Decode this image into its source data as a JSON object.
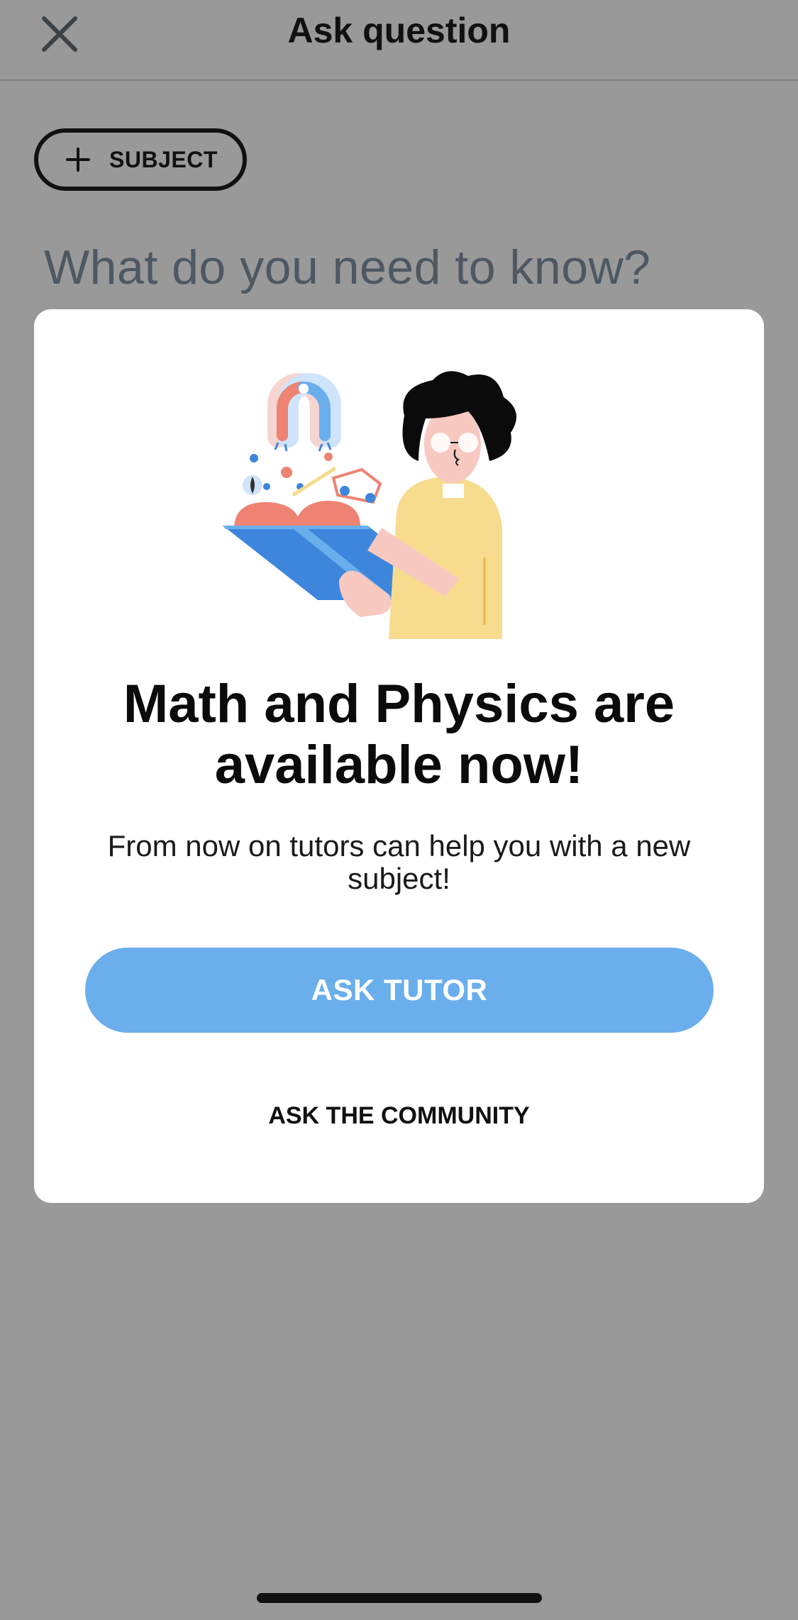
{
  "header": {
    "title": "Ask question",
    "close_icon": "close-icon"
  },
  "subject_chip": {
    "label": "SUBJECT",
    "icon": "plus-icon"
  },
  "question": {
    "placeholder": "What do you need to know?"
  },
  "modal": {
    "illustration": "tutor-with-book-illustration",
    "title": "Math and Physics are available now!",
    "description": "From now on tutors can help you with a new subject!",
    "primary_button": "ASK TUTOR",
    "secondary_link": "ASK THE COMMUNITY"
  },
  "colors": {
    "overlay": "#999999",
    "accent_blue": "#6aaeec",
    "book_blue": "#3d86dc",
    "coral": "#ee8373",
    "sweater_yellow": "#f7dc8e"
  }
}
